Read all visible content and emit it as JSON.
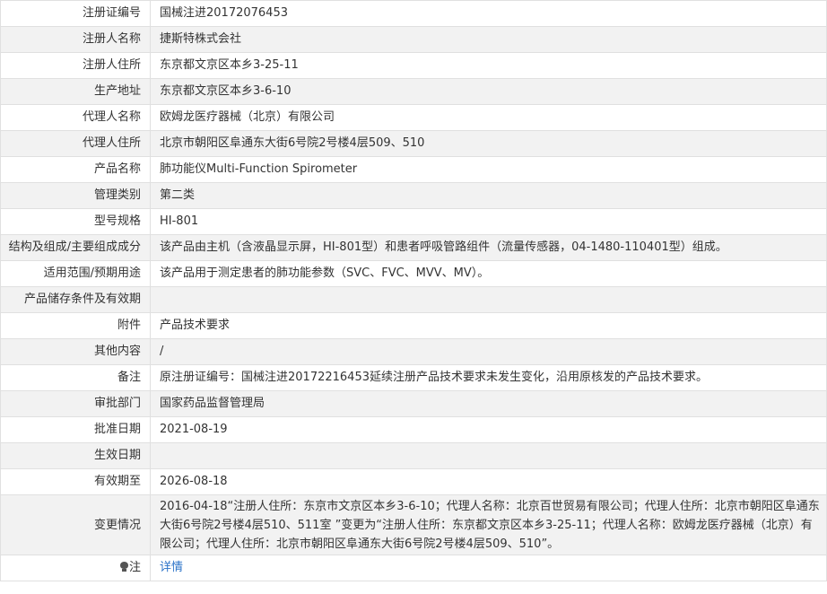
{
  "rows": [
    {
      "label": "注册证编号",
      "value": "国械注进20172076453"
    },
    {
      "label": "注册人名称",
      "value": "捷斯特株式会社"
    },
    {
      "label": "注册人住所",
      "value": "东京都文京区本乡3-25-11"
    },
    {
      "label": "生产地址",
      "value": "东京都文京区本乡3-6-10"
    },
    {
      "label": "代理人名称",
      "value": "欧姆龙医疗器械（北京）有限公司"
    },
    {
      "label": "代理人住所",
      "value": "北京市朝阳区阜通东大街6号院2号楼4层509、510"
    },
    {
      "label": "产品名称",
      "value": "肺功能仪Multi-Function Spirometer"
    },
    {
      "label": "管理类别",
      "value": "第二类"
    },
    {
      "label": "型号规格",
      "value": "HI-801"
    },
    {
      "label": "结构及组成/主要组成成分",
      "value": "该产品由主机（含液晶显示屏，HI-801型）和患者呼吸管路组件（流量传感器，04-1480-110401型）组成。"
    },
    {
      "label": "适用范围/预期用途",
      "value": "该产品用于测定患者的肺功能参数（SVC、FVC、MVV、MV）。"
    },
    {
      "label": "产品储存条件及有效期",
      "value": ""
    },
    {
      "label": "附件",
      "value": "产品技术要求"
    },
    {
      "label": "其他内容",
      "value": "/"
    },
    {
      "label": "备注",
      "value": "原注册证编号：国械注进20172216453延续注册产品技术要求未发生变化，沿用原核发的产品技术要求。"
    },
    {
      "label": "审批部门",
      "value": "国家药品监督管理局"
    },
    {
      "label": "批准日期",
      "value": "2021-08-19"
    },
    {
      "label": "生效日期",
      "value": ""
    },
    {
      "label": "有效期至",
      "value": "2026-08-18"
    },
    {
      "label": "变更情况",
      "value": "2016-04-18“注册人住所：东京市文京区本乡3-6-10；代理人名称：北京百世贸易有限公司；代理人住所：北京市朝阳区阜通东大街6号院2号楼4层510、511室 ”变更为“注册人住所：东京都文京区本乡3-25-11；代理人名称：欧姆龙医疗器械（北京）有限公司；代理人住所：北京市朝阳区阜通东大街6号院2号楼4层509、510”。"
    }
  ],
  "note": {
    "label": "注",
    "icon": "bulb-icon",
    "link_text": "详情",
    "link_color": "#2a72c8"
  }
}
